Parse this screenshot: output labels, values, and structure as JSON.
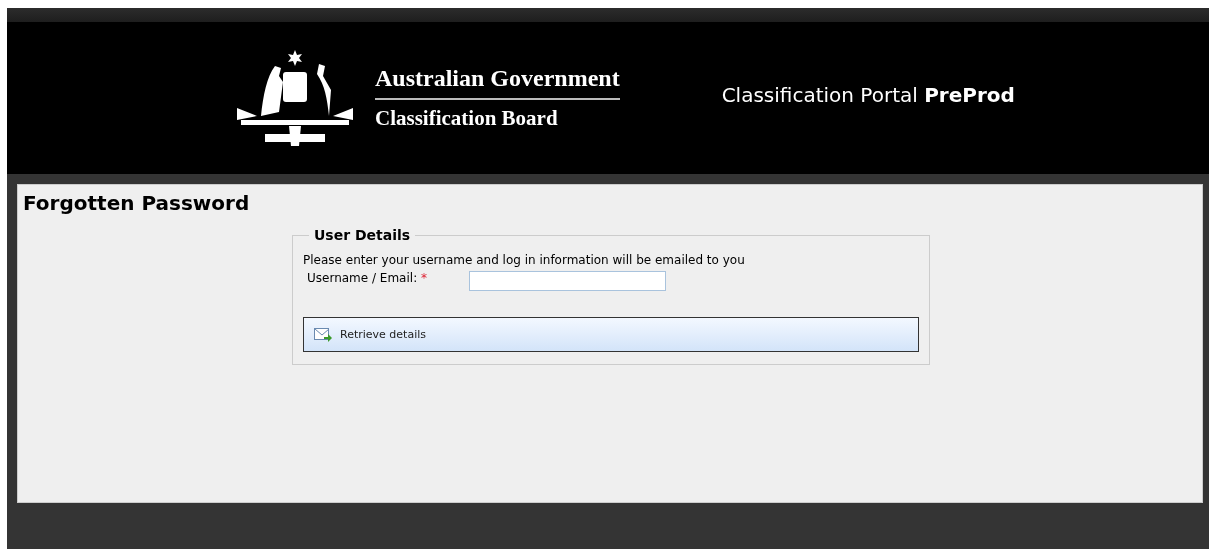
{
  "header": {
    "agency": "Australian Government",
    "board": "Classification Board",
    "portal_title": "Classification Portal **PreProd**"
  },
  "page": {
    "title": "Forgotten Password"
  },
  "fieldset": {
    "legend": "User Details",
    "instructions": "Please enter your username and log in information will be emailed to you",
    "field": {
      "label": "Username / Email:",
      "required_mark": "*",
      "required": true
    },
    "button": "Retrieve details"
  }
}
